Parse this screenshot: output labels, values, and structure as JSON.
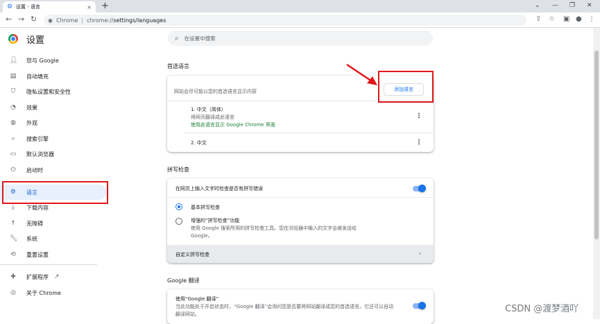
{
  "browser": {
    "tab_title": "设置 - 语言",
    "tab_close": "×",
    "new_tab": "+",
    "site_label": "Chrome",
    "separator": "|",
    "url_scheme": "chrome://",
    "url_path": "settings/languages",
    "window_controls": [
      "⌄",
      "—",
      "❐",
      "✕"
    ]
  },
  "header": {
    "title": "设置",
    "search_placeholder": "在设置中搜索"
  },
  "sidebar": {
    "items": [
      {
        "label": "您与 Google",
        "icon": "person-icon"
      },
      {
        "label": "自动填充",
        "icon": "autofill-icon"
      },
      {
        "label": "隐私设置和安全性",
        "icon": "shield-icon"
      },
      {
        "label": "效果",
        "icon": "speedometer-icon"
      },
      {
        "label": "外观",
        "icon": "palette-icon"
      },
      {
        "label": "搜索引擎",
        "icon": "search-icon"
      },
      {
        "label": "默认浏览器",
        "icon": "browser-icon"
      },
      {
        "label": "启动时",
        "icon": "power-icon"
      },
      {
        "label": "语言",
        "icon": "globe-icon",
        "active": true
      },
      {
        "label": "下载内容",
        "icon": "download-icon"
      },
      {
        "label": "无障碍",
        "icon": "accessibility-icon"
      },
      {
        "label": "系统",
        "icon": "wrench-icon"
      },
      {
        "label": "重置设置",
        "icon": "history-icon"
      },
      {
        "label": "扩展程序",
        "icon": "puzzle-icon"
      },
      {
        "label": "关于 Chrome",
        "icon": "chrome-icon"
      }
    ]
  },
  "languages": {
    "section_title": "首选语言",
    "description": "网站会尽可能以您的首选语言显示内容",
    "add_button": "添加语言",
    "lang1_name": "1. 中文（简体）",
    "lang1_translate": "将网页翻译成此语言",
    "lang1_ui": "使用此语言显示 Google Chrome 界面",
    "lang2_name": "2. 中文"
  },
  "spellcheck": {
    "section_title": "拼写检查",
    "toggle_label": "在网页上输入文字时检查是否有拼写错误",
    "basic_label": "基本拼写检查",
    "enhanced_label": "增强的“拼写检查”功能",
    "enhanced_desc_1": "使用 Google 搜索所用的拼写检查工具。您在浏览器中输入的文字会被发送给",
    "enhanced_desc_2": "Google。",
    "custom_label": "自定义拼写检查"
  },
  "translate": {
    "section_title": "Google 翻译",
    "toggle_label": "使用“Google 翻译”",
    "desc_1": "当此功能处于开启状态时，“Google 翻译”会询问您是否要将网站翻译成您的首选语言。它还可以自动",
    "desc_2": "翻译网站。"
  },
  "watermark": "CSDN @渡梦酒吖",
  "colors": {
    "accent": "#1a73e8",
    "highlight": "#e0161a",
    "active_bg": "#e8f0fe"
  }
}
